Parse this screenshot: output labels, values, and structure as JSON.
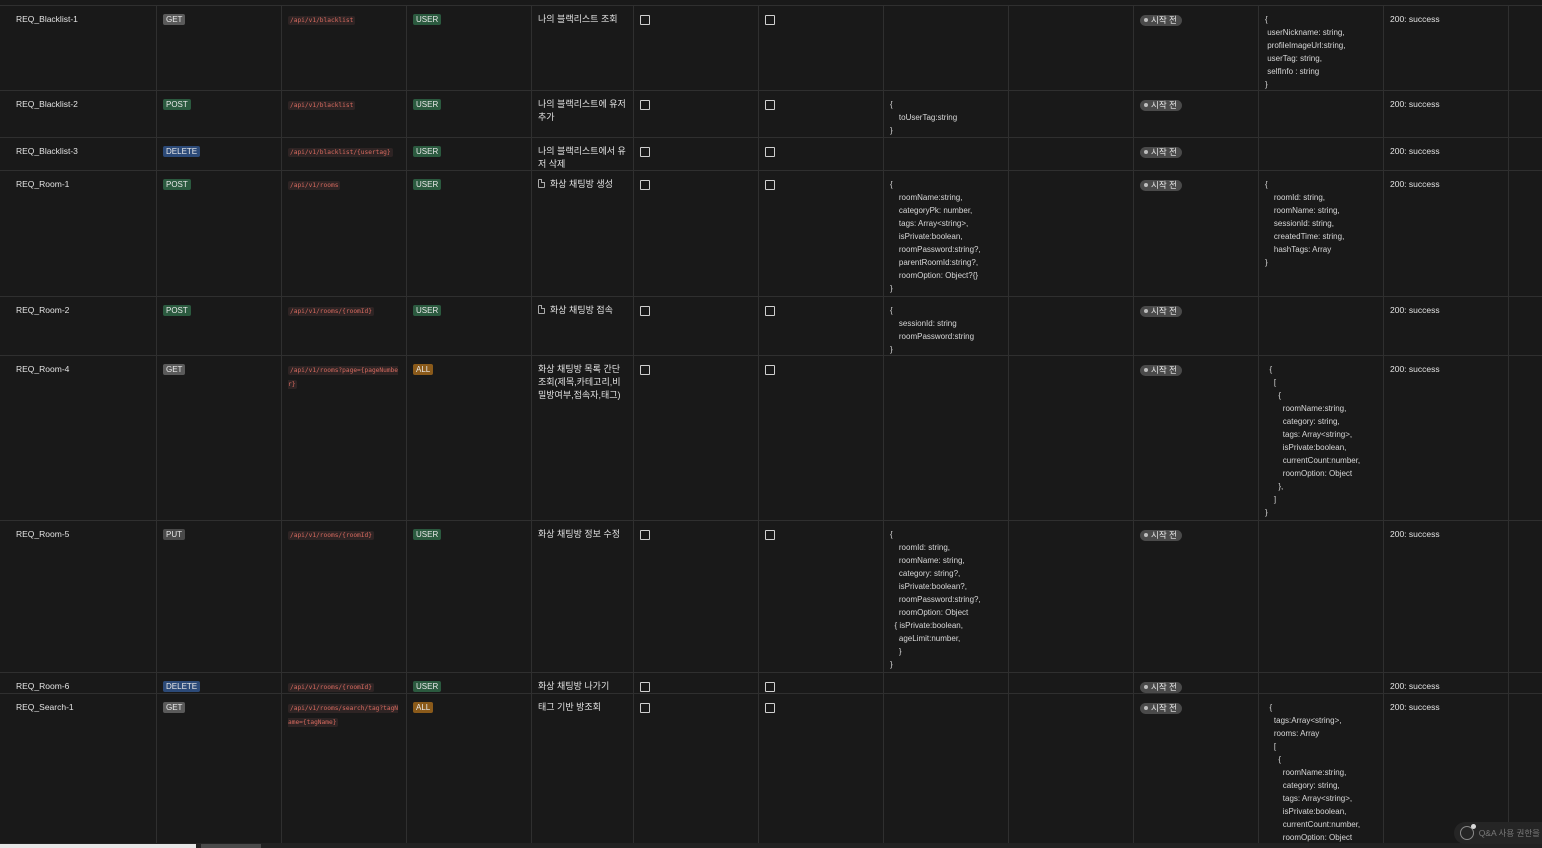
{
  "status_label": "시작 전",
  "rows": [
    {
      "id": "REQ_Blacklist-1",
      "method": "GET",
      "path": "/api/v1/blacklist",
      "role": "USER",
      "desc": "나의 블랙리스트 조회",
      "doc": false,
      "req": "",
      "res": "{\n userNickname: string,\n profileImageUrl:string,\n userTag: string,\n selfInfo : string\n}",
      "code": "200: success"
    },
    {
      "id": "REQ_Blacklist-2",
      "method": "POST",
      "path": "/api/v1/blacklist",
      "role": "USER",
      "desc": "나의 블랙리스트에 유저 추가",
      "doc": false,
      "req": "{\n    toUserTag:string\n}",
      "res": "",
      "code": "200: success"
    },
    {
      "id": "REQ_Blacklist-3",
      "method": "DELETE",
      "path": "/api/v1/blacklist/{usertag}",
      "role": "USER",
      "desc": "나의 블랙리스트에서 유저 삭제",
      "doc": false,
      "req": "",
      "res": "",
      "code": "200: success"
    },
    {
      "id": "REQ_Room-1",
      "method": "POST",
      "path": "/api/v1/rooms",
      "role": "USER",
      "desc": "화상 채팅방 생성",
      "doc": true,
      "req": "{\n    roomName:string,\n    categoryPk: number,\n    tags: Array<string>,\n    isPrivate:boolean,\n    roomPassword:string?,\n    parentRoomId:string?,\n    roomOption: Object?{}\n}",
      "res": "{\n    roomId: string,\n    roomName: string,\n    sessionId: string,\n    createdTime: string,\n    hashTags: Array\n}",
      "code": "200: success"
    },
    {
      "id": "REQ_Room-2",
      "method": "POST",
      "path": "/api/v1/rooms/{roomId}",
      "role": "USER",
      "desc": "화상 채팅방 접속",
      "doc": true,
      "req": "{\n    sessionId: string\n    roomPassword:string\n}",
      "res": "",
      "code": "200: success"
    },
    {
      "id": "REQ_Room-4",
      "method": "GET",
      "path": "/api/v1/rooms?page={pageNumber}",
      "role": "ALL",
      "desc": "화상 채팅방 목록 간단 조회(제목,카테고리,비밀방여부,접속자,태그)",
      "doc": false,
      "req": "",
      "res": "  {\n    [\n      {\n        roomName:string,\n        category: string,\n        tags: Array<string>,\n        isPrivate:boolean,\n        currentCount:number,\n        roomOption: Object\n      },\n    ]\n}",
      "code": "200: success"
    },
    {
      "id": "REQ_Room-5",
      "method": "PUT",
      "path": "/api/v1/rooms/{roomId}",
      "role": "USER",
      "desc": "화상 채팅방 정보 수정",
      "doc": false,
      "req": "{\n    roomId: string,\n    roomName: string,\n    category: string?,\n    isPrivate:boolean?,\n    roomPassword:string?,\n    roomOption: Object\n  { isPrivate:boolean,\n    ageLimit:number,\n    }\n}",
      "res": "",
      "code": "200: success"
    },
    {
      "id": "REQ_Room-6",
      "method": "DELETE",
      "path": "/api/v1/rooms/{roomId}",
      "role": "USER",
      "desc": "화상 채팅방 나가기",
      "doc": false,
      "req": "",
      "res": "",
      "code": "200: success"
    },
    {
      "id": "REQ_Search-1",
      "method": "GET",
      "path": "/api/v1/rooms/search/tag?tagName={tagName}",
      "role": "ALL",
      "desc": "태그 기반 방조회",
      "doc": false,
      "req": "",
      "res": "  {\n    tags:Array<string>,\n    rooms: Array\n    [\n      {\n        roomName:string,\n        category: string,\n        tags: Array<string>,\n        isPrivate:boolean,\n        currentCount:number,\n        roomOption: Object",
      "code": "200: success"
    }
  ],
  "qa_widget": {
    "label": "Q&A 사용 권한을",
    "icon": "qa-sparkle-icon"
  }
}
